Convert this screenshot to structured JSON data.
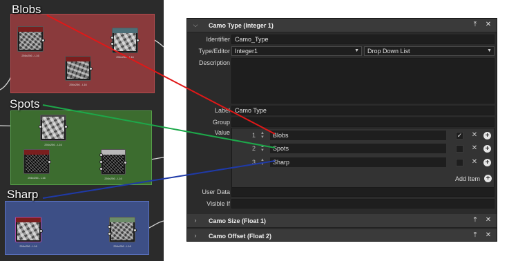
{
  "graph": {
    "frames": [
      {
        "title": "Blobs",
        "color": "#8a3a3c"
      },
      {
        "title": "Spots",
        "color": "#3c6c2f"
      },
      {
        "title": "Sharp",
        "color": "#3d4f86"
      }
    ],
    "nodes": {
      "blobs_noise": "256x256 - L16",
      "blobs_output": "256x256 - L16",
      "blobs_mask": "256x256 - L16",
      "spots_noise": "256x256 - L16",
      "spots_small": "256x256 - L16",
      "spots_output": "256x256 - L16",
      "sharp_noise": "256x256 - L16",
      "sharp_output": "256x256 - L16"
    }
  },
  "panel": {
    "section_main": "Camo Type (Integer 1)",
    "identifier_label": "Identifier",
    "identifier_value": "Camo_Type",
    "type_label": "Type/Editor",
    "type_value": "Integer1",
    "editor_value": "Drop Down List",
    "description_label": "Description",
    "label_label": "Label",
    "label_value": "Camo Type",
    "group_label": "Group",
    "group_value": "",
    "value_label": "Value",
    "items": [
      {
        "num": "1",
        "text": "Blobs",
        "checked": "✓"
      },
      {
        "num": "2",
        "text": "Spots",
        "checked": ""
      },
      {
        "num": "3",
        "text": "Sharp",
        "checked": ""
      }
    ],
    "add_item_label": "Add Item",
    "user_data_label": "User Data",
    "user_data_value": "",
    "visible_if_label": "Visible If",
    "visible_if_value": "",
    "section_size": "Camo Size (Float 1)",
    "section_offset": "Camo Offset (Float 2)"
  },
  "colors": {
    "arrow_red": "#e01818",
    "arrow_green": "#1da84a",
    "arrow_blue": "#1f3aa8"
  }
}
